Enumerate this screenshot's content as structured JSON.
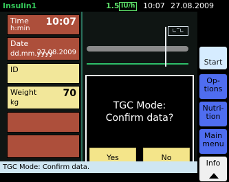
{
  "topbar": {
    "app_name": "Insulin1",
    "rate_value": "1.5",
    "rate_unit": "IU/h",
    "time": "10:07",
    "date": "27.08.2009"
  },
  "fields": {
    "time": {
      "label": "Time",
      "sub": "h:min",
      "value": "10:07"
    },
    "date": {
      "label": "Date",
      "sub": "dd.mm.yyyy",
      "value": "27.08.2009"
    },
    "id": {
      "label": "ID"
    },
    "weight": {
      "label": "Weight",
      "sub": "kg",
      "value": "70"
    }
  },
  "graph": {
    "badge": "∟‾∟"
  },
  "dialog": {
    "title_line1": "TGC Mode:",
    "title_line2": "Confirm data?",
    "yes_label": "Yes",
    "no_label": "No"
  },
  "side_buttons": {
    "start": "Start",
    "options_line1": "Op-",
    "options_line2": "tions",
    "nutrition_line1": "Nutri-",
    "nutrition_line2": "tion",
    "main_menu_line1": "Main",
    "main_menu_line2": "menu",
    "info": "Info"
  },
  "status": {
    "text": "TGC Mode: Confirm data."
  },
  "colors": {
    "field_red": "#ad4f3b",
    "field_yellow": "#f2e79a",
    "accent_green": "#34c759",
    "button_blue": "#4f6df0"
  }
}
